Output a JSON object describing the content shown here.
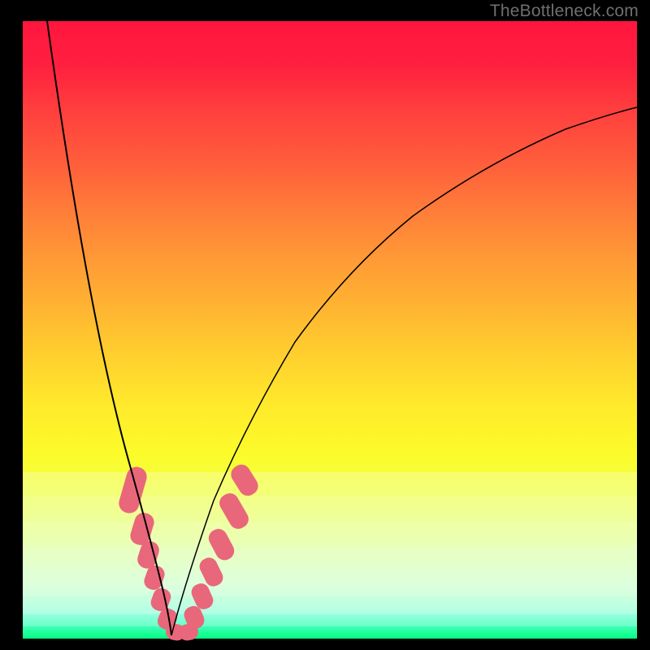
{
  "watermark": "TheBottleneck.com",
  "colors": {
    "bead": "#e9677a",
    "curve": "#000000"
  },
  "chart_data": {
    "type": "line",
    "title": "",
    "xlabel": "",
    "ylabel": "",
    "xlim": [
      0,
      100
    ],
    "ylim": [
      0,
      100
    ],
    "grid": false,
    "notes": "V-shaped bottleneck curve. No numeric axes shown; values below are estimated normalized percentages read from pixel positions (0=left/bottom, 100=right/top). Minimum (bottleneck≈0) near x≈24. Pink bead clusters mark the low-bottleneck region on both sides of the minimum.",
    "series": [
      {
        "name": "left-branch",
        "x": [
          4.0,
          6.3,
          9.5,
          12.7,
          15.9,
          19.0,
          22.2,
          24.2
        ],
        "y": [
          100.0,
          79.3,
          58.3,
          42.5,
          29.5,
          18.0,
          7.5,
          0.5
        ]
      },
      {
        "name": "right-branch",
        "x": [
          24.2,
          26.7,
          31.0,
          36.8,
          44.5,
          54.0,
          65.1,
          77.4,
          90.3,
          100.0
        ],
        "y": [
          0.5,
          9.6,
          22.1,
          35.3,
          47.7,
          58.8,
          68.6,
          76.7,
          82.9,
          86.0
        ]
      }
    ],
    "bead_clusters": [
      {
        "side": "left",
        "x_range": [
          17.3,
          19.2
        ],
        "y_range": [
          26.3,
          15.8
        ]
      },
      {
        "side": "left",
        "x_range": [
          19.2,
          21.6
        ],
        "y_range": [
          15.8,
          10.5
        ]
      },
      {
        "side": "left",
        "x_range": [
          21.6,
          24.2
        ],
        "y_range": [
          10.5,
          0.5
        ]
      },
      {
        "side": "right",
        "x_range": [
          24.2,
          26.7
        ],
        "y_range": [
          0.5,
          9.6
        ]
      },
      {
        "side": "right",
        "x_range": [
          26.7,
          29.0
        ],
        "y_range": [
          9.6,
          15.8
        ]
      },
      {
        "side": "right",
        "x_range": [
          29.0,
          31.9
        ],
        "y_range": [
          15.8,
          26.3
        ]
      }
    ]
  }
}
